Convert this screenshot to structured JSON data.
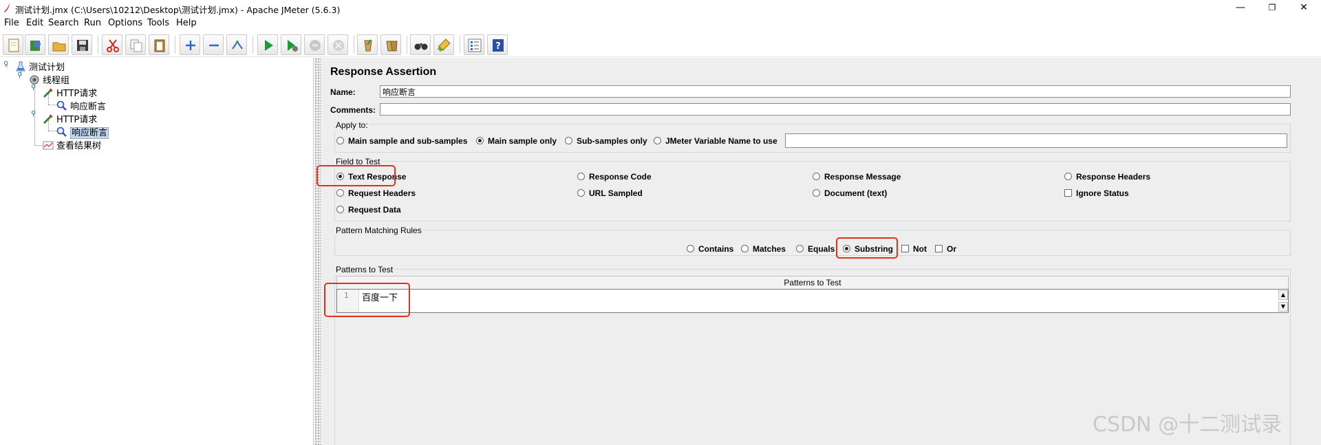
{
  "window": {
    "title": "测试计划.jmx (C:\\Users\\10212\\Desktop\\测试计划.jmx) - Apache JMeter (5.6.3)",
    "controls": {
      "minimize": "—",
      "maximize": "❐",
      "close": "✕"
    }
  },
  "menu": [
    "File",
    "Edit",
    "Search",
    "Run",
    "Options",
    "Tools",
    "Help"
  ],
  "toolbar": [
    "new-icon",
    "templates-icon",
    "open-icon",
    "save-icon",
    "cut-icon",
    "copy-icon",
    "paste-icon",
    "expand-icon",
    "collapse-icon",
    "toggle-icon",
    "start-icon",
    "start-no-pause-icon",
    "stop-icon",
    "shutdown-icon",
    "clear-icon",
    "clear-all-icon",
    "search-icon",
    "reset-search-icon",
    "function-helper-icon",
    "help-icon"
  ],
  "tree": {
    "nodes": [
      {
        "label": "测试计划",
        "icon": "test-plan-icon"
      },
      {
        "label": "线程组",
        "icon": "thread-group-icon"
      },
      {
        "label": "HTTP请求",
        "icon": "http-sampler-icon"
      },
      {
        "label": "响应断言",
        "icon": "assertion-icon"
      },
      {
        "label": "HTTP请求",
        "icon": "http-sampler-icon"
      },
      {
        "label": "响应断言",
        "icon": "assertion-icon",
        "selected": true
      },
      {
        "label": "查看结果树",
        "icon": "listener-icon"
      }
    ]
  },
  "assertion": {
    "title": "Response Assertion",
    "name_label": "Name:",
    "name_value": "响应断言",
    "comments_label": "Comments:",
    "comments_value": "",
    "apply_to": {
      "title": "Apply to:",
      "options": [
        {
          "label": "Main sample and sub-samples",
          "selected": false
        },
        {
          "label": "Main sample only",
          "selected": true
        },
        {
          "label": "Sub-samples only",
          "selected": false
        },
        {
          "label": "JMeter Variable Name to use",
          "selected": false
        }
      ],
      "variable_value": ""
    },
    "field_to_test": {
      "title": "Field to Test",
      "options": [
        {
          "label": "Text Response",
          "selected": true
        },
        {
          "label": "Response Code",
          "selected": false
        },
        {
          "label": "Response Message",
          "selected": false
        },
        {
          "label": "Response Headers",
          "selected": false
        },
        {
          "label": "Request Headers",
          "selected": false
        },
        {
          "label": "URL Sampled",
          "selected": false
        },
        {
          "label": "Document (text)",
          "selected": false
        },
        {
          "label": "Request Data",
          "selected": false
        }
      ],
      "ignore_status": {
        "label": "Ignore Status",
        "checked": false
      }
    },
    "pattern_rules": {
      "title": "Pattern Matching Rules",
      "radios": [
        {
          "label": "Contains",
          "selected": false
        },
        {
          "label": "Matches",
          "selected": false
        },
        {
          "label": "Equals",
          "selected": false
        },
        {
          "label": "Substring",
          "selected": true
        }
      ],
      "checks": [
        {
          "label": "Not",
          "checked": false
        },
        {
          "label": "Or",
          "checked": false
        }
      ]
    },
    "patterns": {
      "title": "Patterns to Test",
      "column_header": "Patterns to Test",
      "rows": [
        {
          "line": "1",
          "text": "百度一下"
        }
      ]
    }
  },
  "watermark": "CSDN @十二测试录",
  "colors": {
    "highlight": "#e0311b",
    "selection": "#c4d8ef",
    "panel_bg": "#eeeeee"
  }
}
